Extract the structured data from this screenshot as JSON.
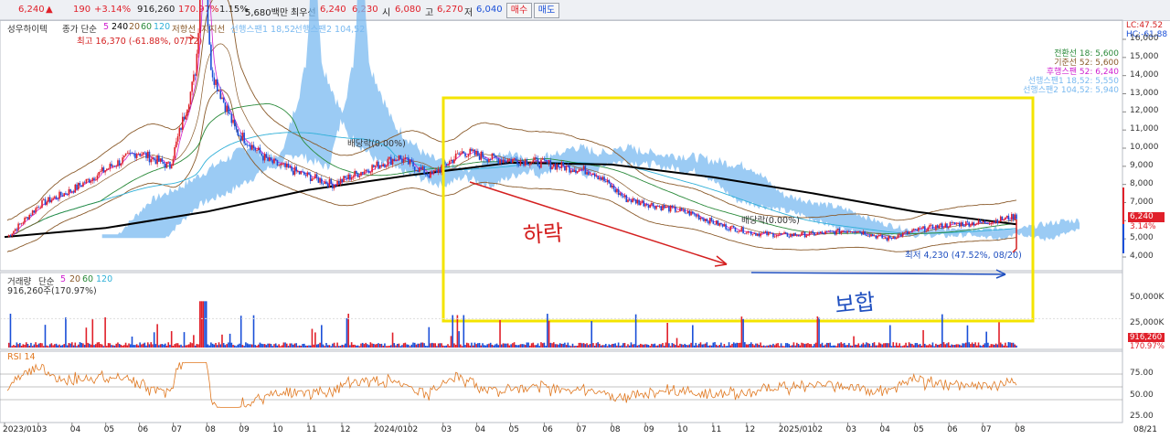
{
  "toolbar": {
    "price": "6,240",
    "price_change": "190",
    "price_change_pct": "+3.14%",
    "volume": "916,260",
    "volume_ratio": "170.97%",
    "turnover": "1.15%",
    "amount": "5,680백만",
    "best_ask_label": "최우선",
    "best_ask": "6,240",
    "best_bid": "6,230",
    "open_label": "시",
    "open": "6,080",
    "high_label": "고",
    "high": "6,270",
    "low_label": "저",
    "low": "6,040",
    "buy_label": "매수",
    "sell_label": "매도"
  },
  "colors": {
    "up": "#e0202a",
    "down": "#1a4fd8",
    "ma5": "#d020d0",
    "ma20": "#8a5a2a",
    "ma60": "#2a8a3a",
    "ma120": "#30b0d8",
    "ma240": "#000000",
    "cloud": "#79b9f0",
    "highlight": "#f4e400",
    "annotation_red": "#d42020",
    "annotation_blue": "#2050c0",
    "rsi": "#e07820"
  },
  "price_panel": {
    "stock_name": "성우하이텍",
    "ma_label": "종가 단순",
    "ma_periods": [
      "5",
      "240",
      "20",
      "60",
      "120"
    ],
    "resistance_label": "저항선",
    "support_label": "지지선",
    "span1_label": "선행스팬1 18,52",
    "span2_label": "선행스팬2 104,52",
    "high_marker": "최고 16,370 (-61.88%, 07/12)",
    "low_marker": "최저 4,230 (47.52%, 08/20)",
    "dividend_label_1": "배당락(0.00%)",
    "dividend_label_2": "배당락(0.00%)",
    "lc_label": "LC:47.52",
    "hc_label": "HC:-61.88",
    "current_price_tag": "6,240",
    "current_pct_tag": "3.14%",
    "right_legend": [
      "전환선 18: 5,600",
      "기준선 52: 5,600",
      "후행스팬 52: 6,240",
      "선행스팬1 18,52: 5,550",
      "선행스팬2 104,52: 5,940"
    ],
    "y_ticks": [
      "16,000",
      "15,000",
      "14,000",
      "13,000",
      "12,000",
      "11,000",
      "10,000",
      "9,000",
      "8,000",
      "7,000",
      "6,000",
      "5,000",
      "4,000"
    ]
  },
  "annotations": {
    "decline": "하락",
    "sideways": "보합"
  },
  "volume_panel": {
    "label": "거래량",
    "ma_label": "단순",
    "ma_periods": [
      "5",
      "20",
      "60",
      "120"
    ],
    "current_volume": "916,260주(170.97%)",
    "y_ticks": [
      "50,000K",
      "25,000K"
    ],
    "current_tag": "916,260",
    "current_pct_tag": "170.97%"
  },
  "rsi_panel": {
    "label": "RSI 14",
    "y_ticks": [
      "75.00",
      "50.00",
      "25.00"
    ]
  },
  "x_axis": {
    "ticks": [
      "2023/01",
      "03",
      "04",
      "05",
      "06",
      "07",
      "08",
      "09",
      "10",
      "11",
      "12",
      "2024/01",
      "02",
      "03",
      "04",
      "05",
      "06",
      "07",
      "08",
      "09",
      "10",
      "11",
      "12",
      "2025/01",
      "02",
      "03",
      "04",
      "05",
      "06",
      "07",
      "08"
    ],
    "end_label": "08/21"
  },
  "chart_data": {
    "type": "line",
    "title": "성우하이텍",
    "x_range": [
      "2023/01",
      "2025/08/21"
    ],
    "ylim": [
      4000,
      16500
    ],
    "series": [
      {
        "name": "종가",
        "x": [
          "2023/01",
          "2023/02",
          "2023/03",
          "2023/04",
          "2023/05",
          "2023/06",
          "2023/07/12",
          "2023/08",
          "2023/09",
          "2023/10",
          "2023/11",
          "2023/12",
          "2024/01",
          "2024/02",
          "2024/03",
          "2024/04",
          "2024/05",
          "2024/06",
          "2024/07",
          "2024/08",
          "2024/09",
          "2024/10",
          "2024/11",
          "2024/12",
          "2025/01",
          "2025/02",
          "2025/03",
          "2025/04",
          "2025/05",
          "2025/06",
          "2025/07",
          "2025/08/21"
        ],
        "values": [
          5100,
          6900,
          7700,
          8800,
          9800,
          9000,
          15500,
          11000,
          9300,
          8600,
          8000,
          8800,
          9500,
          8500,
          9800,
          9400,
          9300,
          9000,
          8700,
          7200,
          6800,
          6400,
          5700,
          5300,
          5200,
          5300,
          5500,
          5000,
          5500,
          5800,
          5900,
          6240
        ]
      },
      {
        "name": "240",
        "x": [
          "2023/01",
          "2023/04",
          "2023/07",
          "2023/10",
          "2024/01",
          "2024/04",
          "2024/07",
          "2024/10",
          "2025/01",
          "2025/04",
          "2025/08/21"
        ],
        "values": [
          5100,
          5600,
          6500,
          7700,
          8500,
          9200,
          9100,
          8400,
          7500,
          6500,
          5800
        ]
      }
    ],
    "volume_ylim": [
      0,
      60000000
    ],
    "rsi_levels": [
      70,
      50,
      30
    ]
  }
}
